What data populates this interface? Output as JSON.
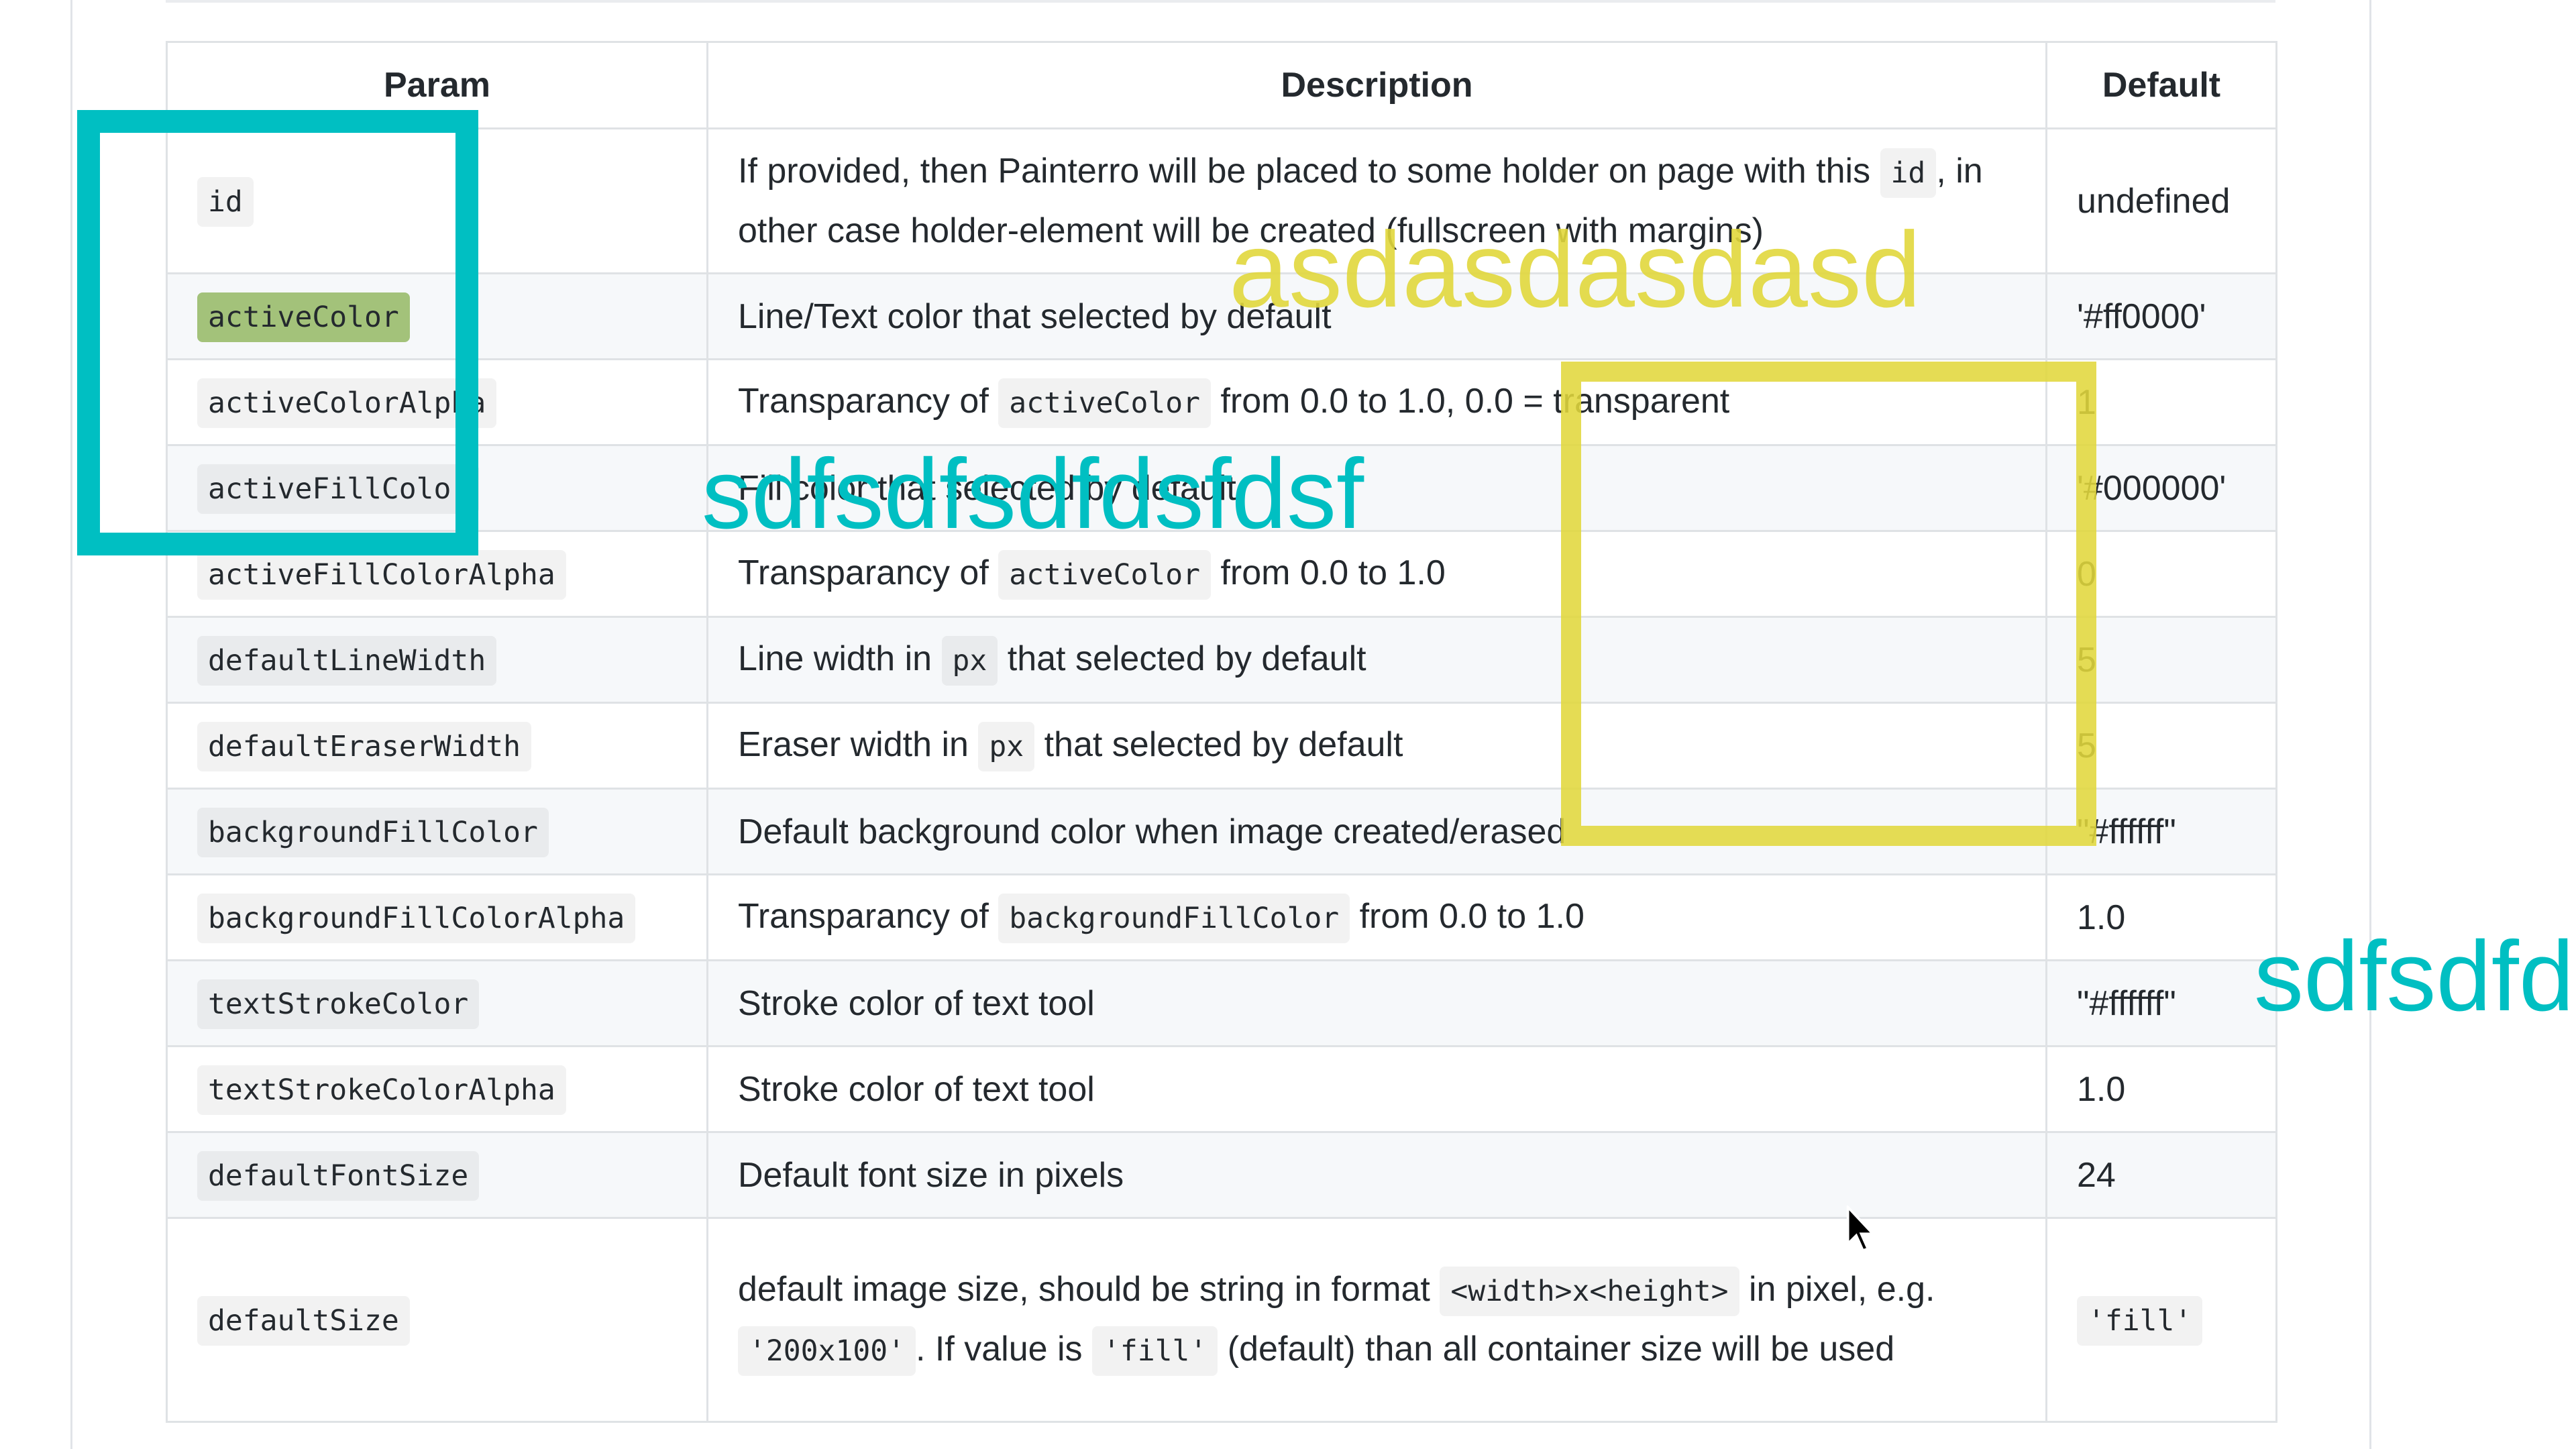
{
  "table": {
    "headers": {
      "param": "Param",
      "description": "Description",
      "default": "Default"
    },
    "rows": [
      {
        "param": "id",
        "description": [
          {
            "t": "If provided, then Painterro will be placed to some holder on page with this "
          },
          {
            "c": "id"
          },
          {
            "t": ", in other case holder-element will be created (fullscreen with margins)"
          }
        ],
        "default": "undefined"
      },
      {
        "param": "activeColor",
        "highlight": true,
        "description": [
          {
            "t": "Line/Text color that selected by default"
          }
        ],
        "default": "'#ff0000'"
      },
      {
        "param": "activeColorAlpha",
        "description": [
          {
            "t": "Transparancy of "
          },
          {
            "c": "activeColor"
          },
          {
            "t": " from 0.0 to 1.0, 0.0 = transparent"
          }
        ],
        "default": "1"
      },
      {
        "param": "activeFillColor",
        "description": [
          {
            "t": "Fill color that selected by default"
          }
        ],
        "default": "'#000000'"
      },
      {
        "param": "activeFillColorAlpha",
        "description": [
          {
            "t": "Transparancy of "
          },
          {
            "c": "activeColor"
          },
          {
            "t": " from 0.0 to 1.0"
          }
        ],
        "default": "0"
      },
      {
        "param": "defaultLineWidth",
        "description": [
          {
            "t": "Line width in "
          },
          {
            "c": "px"
          },
          {
            "t": " that selected by default"
          }
        ],
        "default": "5"
      },
      {
        "param": "defaultEraserWidth",
        "description": [
          {
            "t": "Eraser width in "
          },
          {
            "c": "px"
          },
          {
            "t": " that selected by default"
          }
        ],
        "default": "5"
      },
      {
        "param": "backgroundFillColor",
        "description": [
          {
            "t": "Default background color when image created/erased"
          }
        ],
        "default": "\"#ffffff\""
      },
      {
        "param": "backgroundFillColorAlpha",
        "description": [
          {
            "t": "Transparancy of "
          },
          {
            "c": "backgroundFillColor"
          },
          {
            "t": " from 0.0 to 1.0"
          }
        ],
        "default": "1.0"
      },
      {
        "param": "textStrokeColor",
        "description": [
          {
            "t": "Stroke color of text tool"
          }
        ],
        "default": "\"#ffffff\""
      },
      {
        "param": "textStrokeColorAlpha",
        "description": [
          {
            "t": "Stroke color of text tool"
          }
        ],
        "default": "1.0"
      },
      {
        "param": "defaultFontSize",
        "description": [
          {
            "t": "Default font size in pixels"
          }
        ],
        "default": "24"
      },
      {
        "param": "defaultSize",
        "description": [
          {
            "t": "default image size, should be string in format "
          },
          {
            "c": "<width>x<height>"
          },
          {
            "t": " in pixel, e.g. "
          },
          {
            "c": "'200x100'"
          },
          {
            "t": ". If value is "
          },
          {
            "c": "'fill'"
          },
          {
            "t": " (default) than all container size will be used"
          }
        ],
        "default_code": "'fill'"
      }
    ]
  },
  "annotations": {
    "yellow_text": "asdasdasdasd",
    "cyan_text_1": "sdfsdfsdfdsfdsf",
    "cyan_text_2": "sdfsdfd",
    "colors": {
      "cyan": "#00bfc2",
      "yellow": "#e1d73c",
      "highlight": "#a3c27a"
    }
  }
}
